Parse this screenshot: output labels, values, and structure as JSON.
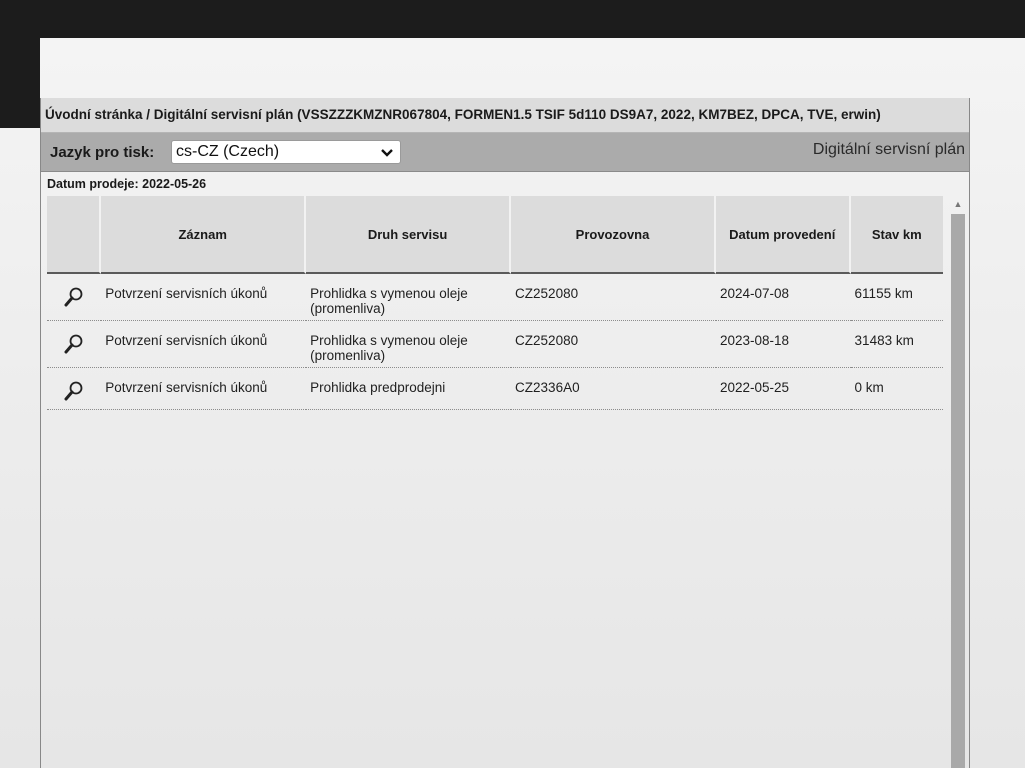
{
  "breadcrumb": "Úvodní stránka / Digitální servisní plán (VSSZZZKMZNR067804, FORMEN1.5 TSIF 5d110 DS9A7, 2022, KM7BEZ, DPCA, TVE, erwin)",
  "toolbar": {
    "language_label": "Jazyk pro tisk:",
    "language_value": "cs-CZ (Czech)",
    "plan_title": "Digitální servisní plán"
  },
  "sale_date": "Datum prodeje: 2022-05-26",
  "table": {
    "headers": [
      "Záznam",
      "Druh servisu",
      "Provozovna",
      "Datum provedení",
      "Stav km"
    ],
    "rows": [
      {
        "record": "Potvrzení servisních úkonů",
        "service": "Prohlidka s vymenou oleje (promenliva)",
        "workshop": "CZ252080",
        "date": "2024-07-08",
        "km": "61155 km"
      },
      {
        "record": "Potvrzení servisních úkonů",
        "service": "Prohlidka s vymenou oleje (promenliva)",
        "workshop": "CZ252080",
        "date": "2023-08-18",
        "km": "31483 km"
      },
      {
        "record": "Potvrzení servisních úkonů",
        "service": "Prohlidka predprodejni",
        "workshop": "CZ2336A0",
        "date": "2022-05-25",
        "km": "0 km"
      }
    ]
  },
  "icons": {
    "row_detail": "magnifier-icon",
    "dropdown": "chevron-down-icon",
    "scroll_up": "scroll-up-arrow-icon"
  },
  "colors": {
    "toolbar_bg": "#ababab",
    "header_bg": "#dcdcdc",
    "scroll_track": "#a9a9a9"
  }
}
